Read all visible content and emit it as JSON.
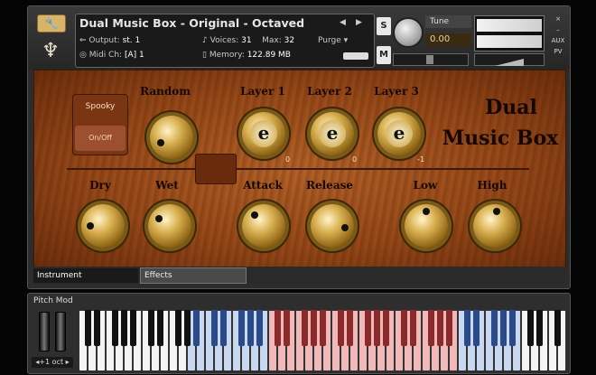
{
  "header": {
    "instrument_title": "Dual Music Box  - Original - Octaved",
    "output_label": "Output:",
    "output_value": "st. 1",
    "voices_label": "Voices:",
    "voices_value": "31",
    "max_label": "Max:",
    "max_value": "32",
    "purge_label": "Purge",
    "midi_label": "Midi Ch:",
    "midi_value": "[A] 1",
    "memory_label": "Memory:",
    "memory_value": "122.89 MB",
    "s_label": "S",
    "m_label": "M",
    "tune_label": "Tune",
    "tune_value": "0.00",
    "side_close": "×",
    "side_aux": "AUX",
    "side_pv": "PV"
  },
  "panel": {
    "title_line1": "Dual",
    "title_line2": "Music Box",
    "spooky_label": "Spooky",
    "onoff_label": "On/Off",
    "knobs_top": [
      {
        "name": "random",
        "label": "Random"
      },
      {
        "name": "layer-1",
        "label": "Layer 1",
        "value": "0"
      },
      {
        "name": "layer-2",
        "label": "Layer 2",
        "value": "0"
      },
      {
        "name": "layer-3",
        "label": "Layer 3",
        "value": "-1"
      }
    ],
    "knobs_bottom": [
      {
        "name": "dry",
        "label": "Dry"
      },
      {
        "name": "wet",
        "label": "Wet"
      },
      {
        "name": "attack",
        "label": "Attack"
      },
      {
        "name": "release",
        "label": "Release"
      },
      {
        "name": "low",
        "label": "Low"
      },
      {
        "name": "high",
        "label": "High"
      }
    ]
  },
  "tabs": [
    {
      "label": "Instrument",
      "active": true
    },
    {
      "label": "Effects",
      "active": false
    }
  ],
  "keyboard": {
    "pitch_mod_label": "Pitch Mod",
    "octave_label": "◂+1 oct ▸",
    "zone_colors": {
      "white": "#f4f4f4",
      "blue": "#c8d8f0",
      "red": "#f0b8b8",
      "black": "#111111",
      "black_blue": "#2a4a8a",
      "black_red": "#8a2a2a"
    }
  }
}
